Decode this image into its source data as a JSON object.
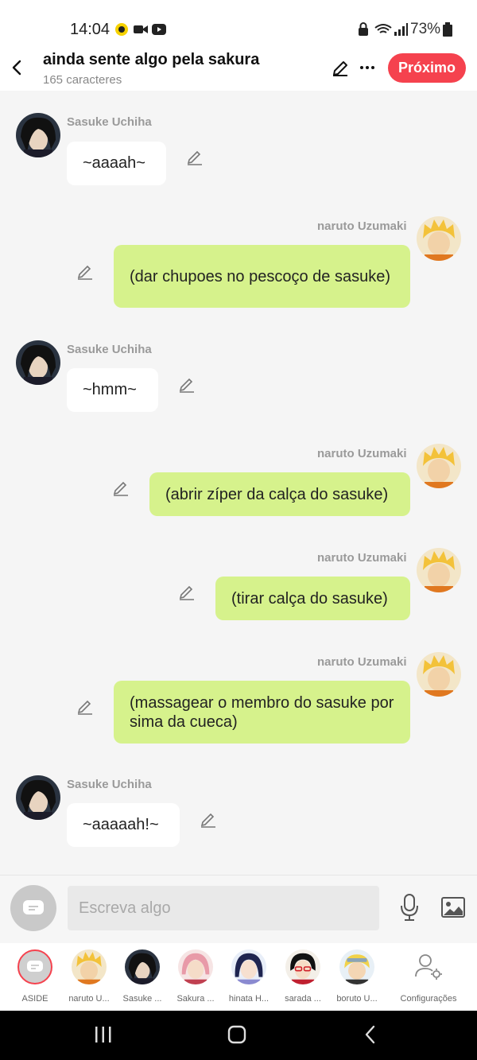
{
  "status_bar": {
    "time": "14:04",
    "battery": "73%"
  },
  "header": {
    "title": "ainda sente algo pela sakura",
    "subtitle": "165 caracteres",
    "next_label": "Próximo"
  },
  "messages": [
    {
      "side": "left",
      "name": "Sasuke Uchiha",
      "text": "~aaaah~"
    },
    {
      "side": "right",
      "name": "naruto Uzumaki",
      "text": "(dar chupoes no pescoço de sasuke)"
    },
    {
      "side": "left",
      "name": "Sasuke Uchiha",
      "text": "~hmm~"
    },
    {
      "side": "right",
      "name": "naruto Uzumaki",
      "text": "(abrir zíper da calça do sasuke)"
    },
    {
      "side": "right",
      "name": "naruto Uzumaki",
      "text": "(tirar calça do sasuke)"
    },
    {
      "side": "right",
      "name": "naruto Uzumaki",
      "text": "(massagear o membro do sasuke por sima da cueca)"
    },
    {
      "side": "left",
      "name": "Sasuke Uchiha",
      "text": "~aaaaah!~"
    }
  ],
  "composer": {
    "placeholder": "Escreva algo"
  },
  "characters": [
    {
      "label": "ASIDE"
    },
    {
      "label": "naruto U..."
    },
    {
      "label": "Sasuke ..."
    },
    {
      "label": "Sakura ..."
    },
    {
      "label": "hinata H..."
    },
    {
      "label": "sarada ..."
    },
    {
      "label": "boruto U..."
    },
    {
      "label": "Configurações"
    }
  ],
  "colors": {
    "accent": "#f5424e",
    "bubble_right": "#d6f28c",
    "bubble_left": "#ffffff"
  }
}
